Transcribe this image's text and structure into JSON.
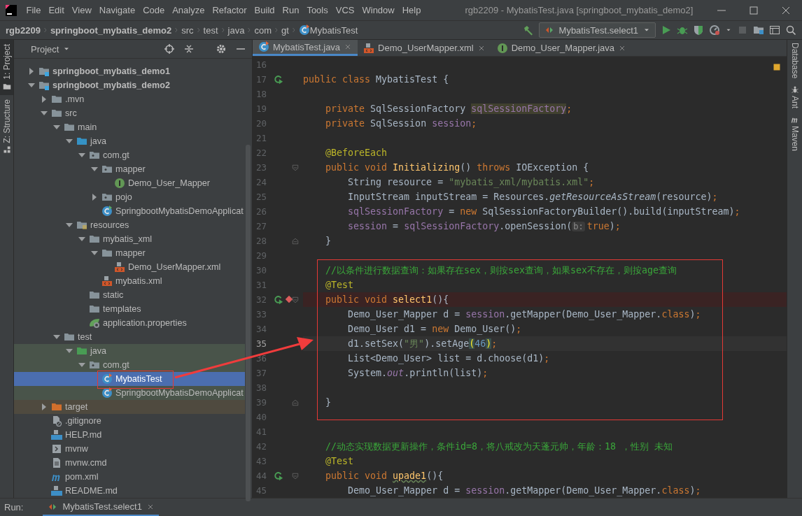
{
  "window": {
    "title": "rgb2209 - MybatisTest.java [springboot_mybatis_demo2]"
  },
  "menu": [
    "File",
    "Edit",
    "View",
    "Navigate",
    "Code",
    "Analyze",
    "Refactor",
    "Build",
    "Run",
    "Tools",
    "VCS",
    "Window",
    "Help"
  ],
  "breadcrumbs": [
    {
      "label": "rgb2209",
      "kind": "project"
    },
    {
      "label": "springboot_mybatis_demo2",
      "kind": "module"
    },
    {
      "label": "src",
      "kind": "folder"
    },
    {
      "label": "test",
      "kind": "folder"
    },
    {
      "label": "java",
      "kind": "folder"
    },
    {
      "label": "com",
      "kind": "folder"
    },
    {
      "label": "gt",
      "kind": "folder"
    },
    {
      "label": "MybatisTest",
      "kind": "class"
    }
  ],
  "run_config": {
    "label": "MybatisTest.select1"
  },
  "left_strip": [
    {
      "label": "1: Project",
      "kind": "project",
      "selected": true
    },
    {
      "label": "Z: Structure",
      "kind": "structure",
      "selected": false
    }
  ],
  "project_panel": {
    "title": "Project",
    "tree": [
      {
        "label": "springboot_mybatis_demo1",
        "kind": "module",
        "expanded": false,
        "selected": false
      },
      {
        "label": "springboot_mybatis_demo2",
        "kind": "module",
        "expanded": true,
        "selected": false,
        "children": [
          {
            "label": ".mvn",
            "kind": "folder",
            "expanded": false,
            "selected": false
          },
          {
            "label": "src",
            "kind": "folder",
            "expanded": true,
            "selected": false,
            "children": [
              {
                "label": "main",
                "kind": "folder",
                "expanded": true,
                "selected": false,
                "children": [
                  {
                    "label": "java",
                    "kind": "source-folder",
                    "expanded": true,
                    "selected": false,
                    "children": [
                      {
                        "label": "com.gt",
                        "kind": "package",
                        "expanded": true,
                        "selected": false,
                        "children": [
                          {
                            "label": "mapper",
                            "kind": "package",
                            "expanded": true,
                            "selected": false,
                            "children": [
                              {
                                "label": "Demo_User_Mapper",
                                "kind": "interface",
                                "selected": false
                              }
                            ]
                          },
                          {
                            "label": "pojo",
                            "kind": "package",
                            "expanded": false,
                            "selected": false
                          },
                          {
                            "label": "SpringbootMybatisDemoApplicat",
                            "kind": "app-class",
                            "selected": false
                          }
                        ]
                      }
                    ]
                  },
                  {
                    "label": "resources",
                    "kind": "resources-folder",
                    "expanded": true,
                    "selected": false,
                    "children": [
                      {
                        "label": "mybatis_xml",
                        "kind": "folder",
                        "expanded": true,
                        "selected": false,
                        "children": [
                          {
                            "label": "mapper",
                            "kind": "folder",
                            "expanded": true,
                            "selected": false,
                            "children": [
                              {
                                "label": "Demo_UserMapper.xml",
                                "kind": "xml",
                                "selected": false
                              }
                            ]
                          },
                          {
                            "label": "mybatis.xml",
                            "kind": "xml",
                            "selected": false
                          }
                        ]
                      },
                      {
                        "label": "static",
                        "kind": "folder",
                        "selected": false
                      },
                      {
                        "label": "templates",
                        "kind": "folder",
                        "selected": false
                      },
                      {
                        "label": "application.properties",
                        "kind": "properties",
                        "selected": false
                      }
                    ]
                  }
                ]
              },
              {
                "label": "test",
                "kind": "folder",
                "expanded": true,
                "selected": false,
                "children": [
                  {
                    "label": "java",
                    "kind": "test-folder",
                    "expanded": true,
                    "selected": false,
                    "children": [
                      {
                        "label": "com.gt",
                        "kind": "test-package",
                        "expanded": true,
                        "selected": false,
                        "children": [
                          {
                            "label": "MybatisTest",
                            "kind": "test-class",
                            "selected": true
                          },
                          {
                            "label": "SpringbootMybatisDemoApplicat",
                            "kind": "test-class",
                            "selected": false
                          }
                        ]
                      }
                    ]
                  }
                ]
              }
            ]
          },
          {
            "label": "target",
            "kind": "excluded-folder",
            "expanded": false,
            "selected": false
          },
          {
            "label": ".gitignore",
            "kind": "ignore",
            "selected": false
          },
          {
            "label": "HELP.md",
            "kind": "md",
            "selected": false
          },
          {
            "label": "mvnw",
            "kind": "script",
            "selected": false
          },
          {
            "label": "mvnw.cmd",
            "kind": "text",
            "selected": false
          },
          {
            "label": "pom.xml",
            "kind": "maven",
            "selected": false
          },
          {
            "label": "README.md",
            "kind": "md",
            "selected": false
          }
        ]
      }
    ]
  },
  "editor_tabs": [
    {
      "label": "MybatisTest.java",
      "kind": "class",
      "selected": true
    },
    {
      "label": "Demo_UserMapper.xml",
      "kind": "xml",
      "selected": false
    },
    {
      "label": "Demo_User_Mapper.java",
      "kind": "interface",
      "selected": false
    }
  ],
  "code": {
    "lines": [
      {
        "number": "16",
        "current": false,
        "breakpoint": false,
        "run_icon": false,
        "fold_start": false,
        "fold_end": false
      },
      {
        "number": "17",
        "current": false,
        "breakpoint": false,
        "run_icon": true,
        "fold_start": false,
        "fold_end": false,
        "tokens": [
          {
            "kind": "kw",
            "text": "public class "
          },
          {
            "kind": "plain",
            "text": "MybatisTest {"
          }
        ]
      },
      {
        "number": "18",
        "current": false,
        "breakpoint": false,
        "run_icon": false,
        "fold_start": false,
        "fold_end": false
      },
      {
        "number": "19",
        "current": false,
        "breakpoint": false,
        "run_icon": false,
        "fold_start": false,
        "fold_end": false,
        "tokens": [
          {
            "kind": "kw",
            "text": "    private "
          },
          {
            "kind": "plain",
            "text": "SqlSessionFactory "
          },
          {
            "kind": "field-hl",
            "text": "sqlSessionFactory"
          },
          {
            "kind": "kw",
            "text": ";"
          }
        ]
      },
      {
        "number": "20",
        "current": false,
        "breakpoint": false,
        "run_icon": false,
        "fold_start": false,
        "fold_end": false,
        "tokens": [
          {
            "kind": "kw",
            "text": "    private "
          },
          {
            "kind": "plain",
            "text": "SqlSession "
          },
          {
            "kind": "field",
            "text": "session"
          },
          {
            "kind": "kw",
            "text": ";"
          }
        ]
      },
      {
        "number": "21",
        "current": false,
        "breakpoint": false,
        "run_icon": false,
        "fold_start": false,
        "fold_end": false
      },
      {
        "number": "22",
        "current": false,
        "breakpoint": false,
        "run_icon": false,
        "fold_start": false,
        "fold_end": false,
        "tokens": [
          {
            "kind": "ann",
            "text": "    @BeforeEach"
          }
        ]
      },
      {
        "number": "23",
        "current": false,
        "breakpoint": false,
        "run_icon": false,
        "fold_start": true,
        "fold_end": false,
        "tokens": [
          {
            "kind": "kw",
            "text": "    public void "
          },
          {
            "kind": "fn",
            "text": "Initializing"
          },
          {
            "kind": "plain",
            "text": "() "
          },
          {
            "kind": "kw",
            "text": "throws "
          },
          {
            "kind": "plain",
            "text": "IOException {"
          }
        ]
      },
      {
        "number": "24",
        "current": false,
        "breakpoint": false,
        "run_icon": false,
        "fold_start": false,
        "fold_end": false,
        "tokens": [
          {
            "kind": "plain",
            "text": "        String resource = "
          },
          {
            "kind": "str",
            "text": "\"mybatis_xml/mybatis.xml\""
          },
          {
            "kind": "kw",
            "text": ";"
          }
        ]
      },
      {
        "number": "25",
        "current": false,
        "breakpoint": false,
        "run_icon": false,
        "fold_start": false,
        "fold_end": false,
        "tokens": [
          {
            "kind": "plain",
            "text": "        InputStream inputStream = Resources."
          },
          {
            "kind": "static-fn",
            "text": "getResourceAsStream"
          },
          {
            "kind": "plain",
            "text": "(resource)"
          },
          {
            "kind": "kw",
            "text": ";"
          }
        ]
      },
      {
        "number": "26",
        "current": false,
        "breakpoint": false,
        "run_icon": false,
        "fold_start": false,
        "fold_end": false,
        "tokens": [
          {
            "kind": "field",
            "text": "        sqlSessionFactory"
          },
          {
            "kind": "plain",
            "text": " = "
          },
          {
            "kind": "kw",
            "text": "new "
          },
          {
            "kind": "plain",
            "text": "SqlSessionFactoryBuilder().build(inputStream)"
          },
          {
            "kind": "kw",
            "text": ";"
          }
        ]
      },
      {
        "number": "27",
        "current": false,
        "breakpoint": false,
        "run_icon": false,
        "fold_start": false,
        "fold_end": false,
        "tokens": [
          {
            "kind": "field",
            "text": "        session"
          },
          {
            "kind": "plain",
            "text": " = "
          },
          {
            "kind": "field",
            "text": "sqlSessionFactory"
          },
          {
            "kind": "plain",
            "text": ".openSession("
          },
          {
            "kind": "hint",
            "text": "b:"
          },
          {
            "kind": "kw",
            "text": "true"
          },
          {
            "kind": "plain",
            "text": ")"
          },
          {
            "kind": "kw",
            "text": ";"
          }
        ]
      },
      {
        "number": "28",
        "current": false,
        "breakpoint": false,
        "run_icon": false,
        "fold_start": false,
        "fold_end": true,
        "tokens": [
          {
            "kind": "plain",
            "text": "    }"
          }
        ]
      },
      {
        "number": "29",
        "current": false,
        "breakpoint": false,
        "run_icon": false,
        "fold_start": false,
        "fold_end": false
      },
      {
        "number": "30",
        "current": false,
        "breakpoint": false,
        "run_icon": false,
        "fold_start": false,
        "fold_end": false,
        "tokens": [
          {
            "kind": "comment",
            "text": "    //以条件进行数据查询：如果存在sex，则按sex查询，如果sex不存在，则按age查询"
          }
        ]
      },
      {
        "number": "31",
        "current": false,
        "breakpoint": false,
        "run_icon": false,
        "fold_start": false,
        "fold_end": false,
        "tokens": [
          {
            "kind": "ann",
            "text": "    @Test"
          }
        ]
      },
      {
        "number": "32",
        "current": false,
        "breakpoint": true,
        "run_icon": true,
        "fold_start": true,
        "fold_end": false,
        "tokens": [
          {
            "kind": "kw",
            "text": "    public void "
          },
          {
            "kind": "fn",
            "text": "select1"
          },
          {
            "kind": "plain",
            "text": "(){"
          }
        ]
      },
      {
        "number": "33",
        "current": false,
        "breakpoint": false,
        "run_icon": false,
        "fold_start": false,
        "fold_end": false,
        "tokens": [
          {
            "kind": "plain",
            "text": "        Demo_User_Mapper d = "
          },
          {
            "kind": "field",
            "text": "session"
          },
          {
            "kind": "plain",
            "text": ".getMapper(Demo_User_Mapper."
          },
          {
            "kind": "kw",
            "text": "class"
          },
          {
            "kind": "plain",
            "text": ")"
          },
          {
            "kind": "kw",
            "text": ";"
          }
        ]
      },
      {
        "number": "34",
        "current": false,
        "breakpoint": false,
        "run_icon": false,
        "fold_start": false,
        "fold_end": false,
        "tokens": [
          {
            "kind": "plain",
            "text": "        Demo_User d1 = "
          },
          {
            "kind": "kw",
            "text": "new "
          },
          {
            "kind": "plain",
            "text": "Demo_User()"
          },
          {
            "kind": "kw",
            "text": ";"
          }
        ]
      },
      {
        "number": "35",
        "current": true,
        "breakpoint": false,
        "run_icon": false,
        "fold_start": false,
        "fold_end": false,
        "tokens": [
          {
            "kind": "plain",
            "text": "        d1.setSex("
          },
          {
            "kind": "str",
            "text": "\"男\""
          },
          {
            "kind": "plain",
            "text": ").setAge"
          },
          {
            "kind": "brace",
            "text": "("
          },
          {
            "kind": "num",
            "text": "46"
          },
          {
            "kind": "brace",
            "text": ")"
          },
          {
            "kind": "kw",
            "text": ";"
          }
        ]
      },
      {
        "number": "36",
        "current": false,
        "breakpoint": false,
        "run_icon": false,
        "fold_start": false,
        "fold_end": false,
        "tokens": [
          {
            "kind": "plain",
            "text": "        List<Demo_User> list = d.choose(d1)"
          },
          {
            "kind": "kw",
            "text": ";"
          }
        ]
      },
      {
        "number": "37",
        "current": false,
        "breakpoint": false,
        "run_icon": false,
        "fold_start": false,
        "fold_end": false,
        "tokens": [
          {
            "kind": "plain",
            "text": "        System."
          },
          {
            "kind": "static-field",
            "text": "out"
          },
          {
            "kind": "plain",
            "text": ".println(list)"
          },
          {
            "kind": "kw",
            "text": ";"
          }
        ]
      },
      {
        "number": "38",
        "current": false,
        "breakpoint": false,
        "run_icon": false,
        "fold_start": false,
        "fold_end": false
      },
      {
        "number": "39",
        "current": false,
        "breakpoint": false,
        "run_icon": false,
        "fold_start": false,
        "fold_end": true,
        "tokens": [
          {
            "kind": "plain",
            "text": "    }"
          }
        ]
      },
      {
        "number": "40",
        "current": false,
        "breakpoint": false,
        "run_icon": false,
        "fold_start": false,
        "fold_end": false
      },
      {
        "number": "41",
        "current": false,
        "breakpoint": false,
        "run_icon": false,
        "fold_start": false,
        "fold_end": false
      },
      {
        "number": "42",
        "current": false,
        "breakpoint": false,
        "run_icon": false,
        "fold_start": false,
        "fold_end": false,
        "tokens": [
          {
            "kind": "comment",
            "text": "    //动态实现数据更新操作，条件id=8，将八戒改为天蓬元帅，年龄：18 ，性别 未知"
          }
        ]
      },
      {
        "number": "43",
        "current": false,
        "breakpoint": false,
        "run_icon": false,
        "fold_start": false,
        "fold_end": false,
        "tokens": [
          {
            "kind": "ann",
            "text": "    @Test"
          }
        ]
      },
      {
        "number": "44",
        "current": false,
        "breakpoint": false,
        "run_icon": true,
        "fold_start": true,
        "fold_end": false,
        "tokens": [
          {
            "kind": "kw",
            "text": "    public void "
          },
          {
            "kind": "fn-typo",
            "text": "upade1"
          },
          {
            "kind": "plain",
            "text": "(){"
          }
        ]
      },
      {
        "number": "45",
        "current": false,
        "breakpoint": false,
        "run_icon": false,
        "fold_start": false,
        "fold_end": false,
        "tokens": [
          {
            "kind": "plain",
            "text": "        Demo_User_Mapper d = "
          },
          {
            "kind": "field",
            "text": "session"
          },
          {
            "kind": "plain",
            "text": ".getMapper(Demo_User_Mapper."
          },
          {
            "kind": "kw",
            "text": "class"
          },
          {
            "kind": "plain",
            "text": ")"
          },
          {
            "kind": "kw",
            "text": ";"
          }
        ]
      }
    ]
  },
  "right_strip": [
    {
      "label": "Database",
      "kind": "database"
    },
    {
      "label": "Ant",
      "kind": "ant"
    },
    {
      "label": "Maven",
      "kind": "maven"
    }
  ],
  "run_bar": {
    "label": "Run:",
    "tab": "MybatisTest.select1"
  }
}
